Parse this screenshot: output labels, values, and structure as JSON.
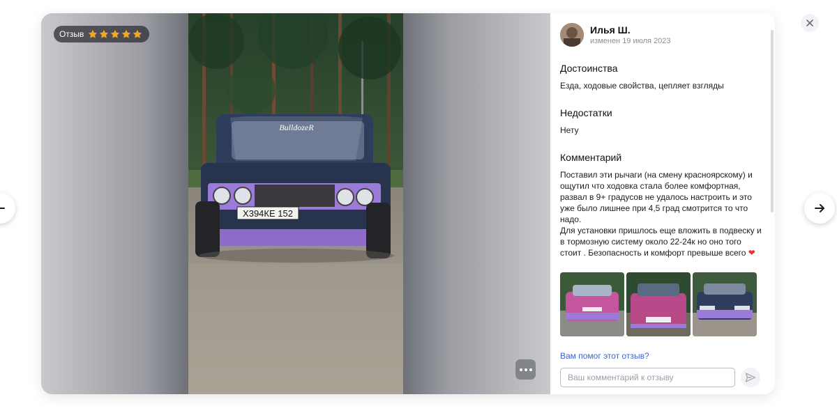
{
  "badge": {
    "label": "Отзыв",
    "rating": 5,
    "max_rating": 5,
    "star_color": "#f5a623"
  },
  "review": {
    "author": "Илья Ш.",
    "date": "изменен 19 июля 2023",
    "pros_title": "Достоинства",
    "pros_text": "Езда, ходовые свойства, цепляет взгляды",
    "cons_title": "Недостатки",
    "cons_text": "Нету",
    "comment_title": "Комментарий",
    "comment_text": "Поставил эти рычаги (на смену красноярскому) и ощутил что ходовка стала более комфортная, развал в 9+ градусов не удалось настроить и это уже было лишнее при 4,5 град смотрится то что надо.\nДля установки пришлось еще вложить в подвеску и в тормозную систему около 22-24к но оно того стоит . Безопасность и комфорт превыше всего",
    "heart_icon": "heart-icon",
    "thumbnails": [
      "review-photo-1",
      "review-photo-2",
      "review-photo-3"
    ],
    "helpful_question": "Вам помог этот отзыв?"
  },
  "comment_box": {
    "placeholder": "Ваш комментарий к отзыву"
  },
  "photo": {
    "plate": "Х394КЕ 152",
    "windshield_sticker": "BulldozeR"
  },
  "icons": {
    "prev": "arrow-left-icon",
    "next": "arrow-right-icon",
    "close": "close-icon",
    "more": "more-dots-icon",
    "send": "send-icon",
    "star": "star-icon"
  },
  "colors": {
    "accent_link": "#3d63d6",
    "heart": "#e3303a",
    "car_body": "#2f3d5c",
    "car_accent": "#9b7ad8"
  }
}
